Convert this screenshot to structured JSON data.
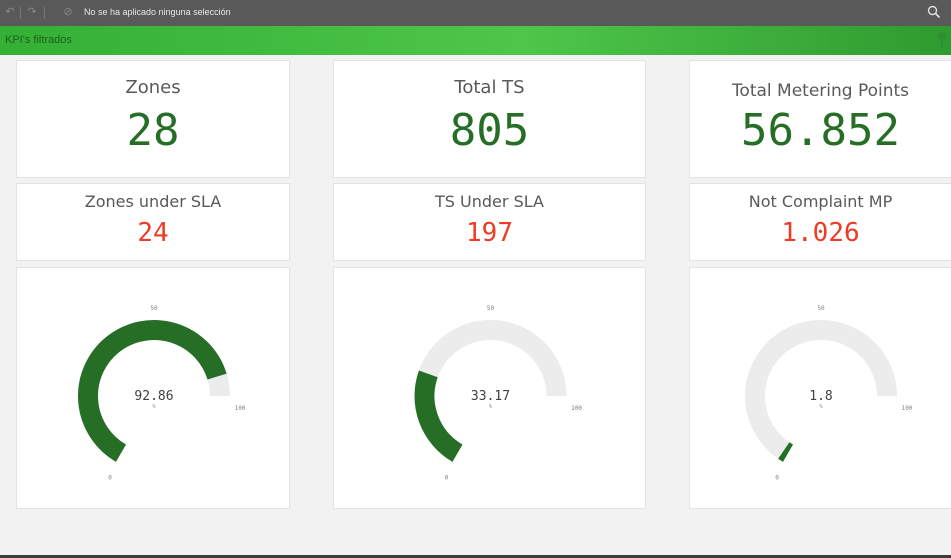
{
  "toolbar": {
    "status": "No se ha aplicado ninguna selección",
    "icons": [
      "back-icon",
      "forward-icon",
      "clear-selections-icon",
      "search-icon"
    ]
  },
  "sheet": {
    "title": "KPI's filtrados"
  },
  "colors": {
    "green": "#266e26",
    "red": "#ed3b26",
    "track": "#ececec",
    "accent": "#3dba3a"
  },
  "kpis": {
    "zones": {
      "title": "Zones",
      "value": "28"
    },
    "total_ts": {
      "title": "Total TS",
      "value": "805"
    },
    "total_mp": {
      "title": "Total Metering Points",
      "value": "56.852"
    },
    "zones_sla": {
      "title": "Zones under SLA",
      "value": "24"
    },
    "ts_sla": {
      "title": "TS Under SLA",
      "value": "197"
    },
    "not_compliant": {
      "title": "Not Complaint MP",
      "value": "1.026"
    }
  },
  "gauges": [
    {
      "value": 92.86,
      "label": "92.86",
      "unit": "%",
      "min": "0",
      "mid": "50",
      "max": "100"
    },
    {
      "value": 33.17,
      "label": "33.17",
      "unit": "%",
      "min": "0",
      "mid": "50",
      "max": "100"
    },
    {
      "value": 1.8,
      "label": "1.8",
      "unit": "%",
      "min": "0",
      "mid": "50",
      "max": "100"
    }
  ]
}
